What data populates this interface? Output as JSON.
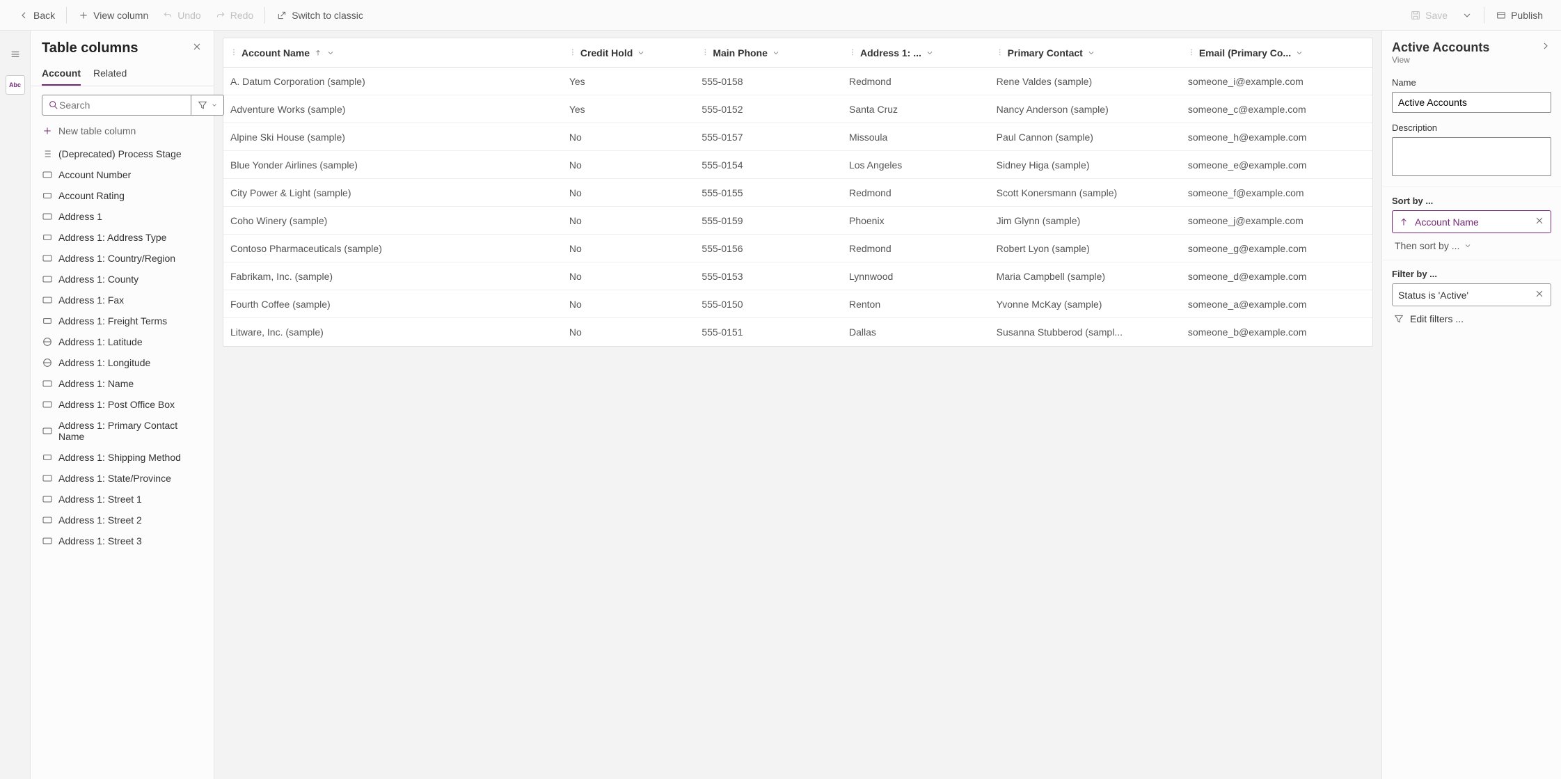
{
  "topbar": {
    "back": "Back",
    "viewColumn": "View column",
    "undo": "Undo",
    "redo": "Redo",
    "switchClassic": "Switch to classic",
    "save": "Save",
    "publish": "Publish"
  },
  "leftPanel": {
    "title": "Table columns",
    "tabs": {
      "account": "Account",
      "related": "Related"
    },
    "searchPlaceholder": "Search",
    "newColumn": "New table column",
    "columns": [
      {
        "label": "(Deprecated) Process Stage",
        "type": "list"
      },
      {
        "label": "Account Number",
        "type": "text"
      },
      {
        "label": "Account Rating",
        "type": "option"
      },
      {
        "label": "Address 1",
        "type": "text"
      },
      {
        "label": "Address 1: Address Type",
        "type": "option"
      },
      {
        "label": "Address 1: Country/Region",
        "type": "text"
      },
      {
        "label": "Address 1: County",
        "type": "text"
      },
      {
        "label": "Address 1: Fax",
        "type": "text"
      },
      {
        "label": "Address 1: Freight Terms",
        "type": "option"
      },
      {
        "label": "Address 1: Latitude",
        "type": "globe"
      },
      {
        "label": "Address 1: Longitude",
        "type": "globe"
      },
      {
        "label": "Address 1: Name",
        "type": "text"
      },
      {
        "label": "Address 1: Post Office Box",
        "type": "text"
      },
      {
        "label": "Address 1: Primary Contact Name",
        "type": "text"
      },
      {
        "label": "Address 1: Shipping Method",
        "type": "option"
      },
      {
        "label": "Address 1: State/Province",
        "type": "text"
      },
      {
        "label": "Address 1: Street 1",
        "type": "text"
      },
      {
        "label": "Address 1: Street 2",
        "type": "text"
      },
      {
        "label": "Address 1: Street 3",
        "type": "text"
      }
    ]
  },
  "grid": {
    "headers": {
      "accountName": "Account Name",
      "creditHold": "Credit Hold",
      "mainPhone": "Main Phone",
      "address1": "Address 1: ...",
      "primaryContact": "Primary Contact",
      "email": "Email (Primary Co..."
    },
    "rows": [
      {
        "name": "A. Datum Corporation (sample)",
        "credit": "Yes",
        "phone": "555-0158",
        "addr": "Redmond",
        "contact": "Rene Valdes (sample)",
        "email": "someone_i@example.com"
      },
      {
        "name": "Adventure Works (sample)",
        "credit": "Yes",
        "phone": "555-0152",
        "addr": "Santa Cruz",
        "contact": "Nancy Anderson (sample)",
        "email": "someone_c@example.com"
      },
      {
        "name": "Alpine Ski House (sample)",
        "credit": "No",
        "phone": "555-0157",
        "addr": "Missoula",
        "contact": "Paul Cannon (sample)",
        "email": "someone_h@example.com"
      },
      {
        "name": "Blue Yonder Airlines (sample)",
        "credit": "No",
        "phone": "555-0154",
        "addr": "Los Angeles",
        "contact": "Sidney Higa (sample)",
        "email": "someone_e@example.com"
      },
      {
        "name": "City Power & Light (sample)",
        "credit": "No",
        "phone": "555-0155",
        "addr": "Redmond",
        "contact": "Scott Konersmann (sample)",
        "email": "someone_f@example.com"
      },
      {
        "name": "Coho Winery (sample)",
        "credit": "No",
        "phone": "555-0159",
        "addr": "Phoenix",
        "contact": "Jim Glynn (sample)",
        "email": "someone_j@example.com"
      },
      {
        "name": "Contoso Pharmaceuticals (sample)",
        "credit": "No",
        "phone": "555-0156",
        "addr": "Redmond",
        "contact": "Robert Lyon (sample)",
        "email": "someone_g@example.com"
      },
      {
        "name": "Fabrikam, Inc. (sample)",
        "credit": "No",
        "phone": "555-0153",
        "addr": "Lynnwood",
        "contact": "Maria Campbell (sample)",
        "email": "someone_d@example.com"
      },
      {
        "name": "Fourth Coffee (sample)",
        "credit": "No",
        "phone": "555-0150",
        "addr": "Renton",
        "contact": "Yvonne McKay (sample)",
        "email": "someone_a@example.com"
      },
      {
        "name": "Litware, Inc. (sample)",
        "credit": "No",
        "phone": "555-0151",
        "addr": "Dallas",
        "contact": "Susanna Stubberod (sampl...",
        "email": "someone_b@example.com"
      }
    ]
  },
  "rightPanel": {
    "title": "Active Accounts",
    "subtitle": "View",
    "nameLabel": "Name",
    "nameValue": "Active Accounts",
    "descLabel": "Description",
    "descValue": "",
    "sortLabel": "Sort by ...",
    "sortChip": "Account Name",
    "thenSort": "Then sort by ...",
    "filterLabel": "Filter by ...",
    "filterChip": "Status is 'Active'",
    "editFilters": "Edit filters ..."
  }
}
